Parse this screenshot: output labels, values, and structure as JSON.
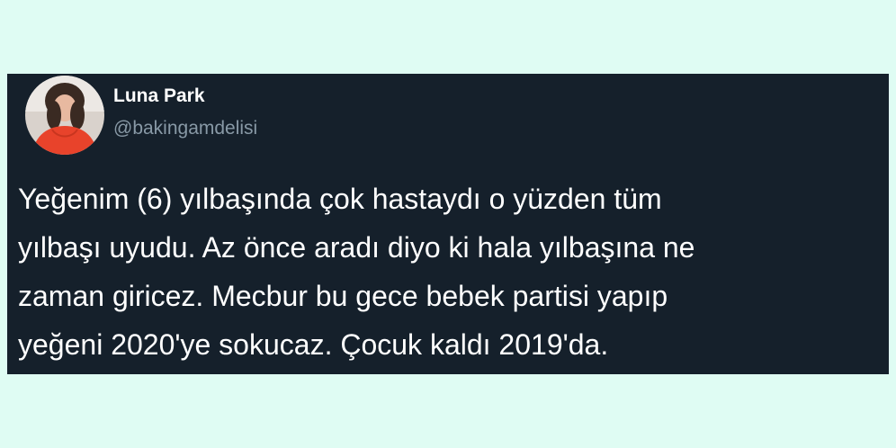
{
  "tweet": {
    "author": {
      "name": "Luna Park",
      "handle": "@bakingamdelisi"
    },
    "text_lines": [
      "Yeğenim (6) yılbaşında çok hastaydı o yüzden tüm",
      "yılbaşı uyudu. Az önce aradı diyo ki hala yılbaşına ne",
      "zaman giricez. Mecbur bu gece bebek partisi yapıp",
      "yeğeni 2020'ye sokucaz. Çocuk kaldı 2019'da."
    ]
  },
  "colors": {
    "page_background": "#dffcf3",
    "card_background": "#15202b",
    "text_primary": "#ffffff",
    "text_secondary": "#8899a6",
    "avatar_shirt": "#e8432b"
  }
}
